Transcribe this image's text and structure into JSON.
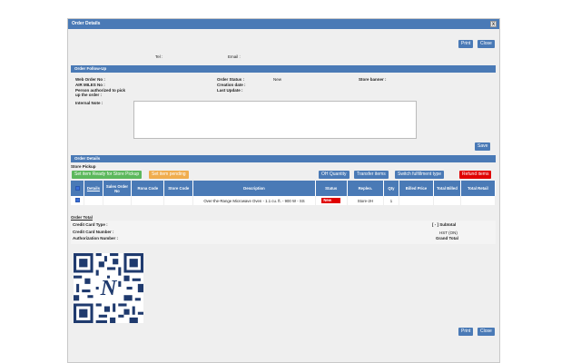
{
  "window": {
    "title": "Order Details",
    "close_glyph": "x"
  },
  "top_buttons": {
    "print": "Print",
    "close": "Close"
  },
  "bottom_buttons": {
    "print": "Print",
    "close": "Close"
  },
  "contact": {
    "tel_label": "Tel :",
    "email_label": "Email :"
  },
  "followup": {
    "section_title": "Order Follow-Up",
    "web_order_no": "Web Order No :",
    "air_miles_no": "AIR MILES No :",
    "authorized_person": "Person authorized to pick up the order :",
    "internal_note": "Internal Note :",
    "order_status_label": "Order Status :",
    "order_status_value": "New",
    "creation_date": "Creation date :",
    "last_update": "Last Update :",
    "store_banner": "Store banner :",
    "save": "Save"
  },
  "details": {
    "section_title": "Order Details",
    "store_pickup": "Store Pickup",
    "btn_ready": "Set item Ready for Store Pickup",
    "btn_pending": "Set item pending",
    "btn_oh_qty": "OH Quantity",
    "btn_transfer": "Transfer items",
    "btn_switch": "Switch fulfillment type",
    "btn_refund": "Refund items",
    "columns": {
      "check": "✔",
      "details": "Details",
      "sales_order": "Sales Order No",
      "rona_code": "Rona Code",
      "store_code": "Store Code",
      "description": "Description",
      "status": "Status",
      "repleo": "Repleo.",
      "qty": "Qty",
      "billed_price": "Billed Price",
      "total_billed": "Total Billed",
      "total_retail": "Total Retail"
    },
    "rows": [
      {
        "description": "Over-the-Range Microwave Oven - 1.1 cu. ft. - 900 W - SS",
        "status": "New",
        "repleo": "Store-2H",
        "qty": "1"
      }
    ]
  },
  "total": {
    "title": "Order Total",
    "credit_card_type": "Credit Card Type :",
    "credit_card_number": "Credit Card Number :",
    "authorization_number": "Authorization Number :",
    "subtotal": "[ - ] Subtotal",
    "hst": "HST (ON)",
    "grand_total": "Grand Total"
  },
  "qr": {
    "icon": "qr-code-icon",
    "center_glyph": "N"
  },
  "colors": {
    "accent": "#4a7ab6",
    "green": "#5cb85c",
    "orange": "#f0ad4e",
    "red": "#e00000"
  }
}
